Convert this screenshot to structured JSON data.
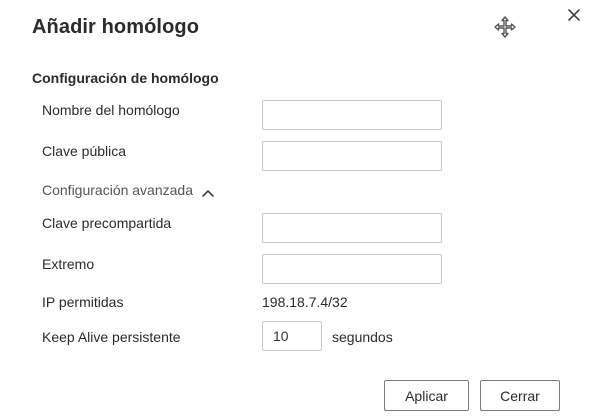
{
  "dialog": {
    "title": "Añadir homólogo"
  },
  "section": {
    "title": "Configuración de homólogo"
  },
  "fields": {
    "peer_name": {
      "label": "Nombre del homólogo",
      "value": ""
    },
    "public_key": {
      "label": "Clave pública",
      "value": ""
    },
    "advanced": {
      "label": "Configuración avanzada",
      "expanded": true
    },
    "preshared_key": {
      "label": "Clave precompartida",
      "value": ""
    },
    "endpoint": {
      "label": "Extremo",
      "value": ""
    },
    "allowed_ips": {
      "label": "IP permitidas",
      "value": "198.18.7.4/32"
    },
    "keepalive": {
      "label": "Keep Alive persistente",
      "value": "10",
      "unit": "segundos"
    }
  },
  "buttons": {
    "apply": "Aplicar",
    "cancel": "Cerrar"
  },
  "icons": {
    "move": "move-icon",
    "close": "close-icon",
    "chevron": "chevron-up-icon"
  },
  "colors": {
    "text": "#2b2b2b",
    "border": "#c8c8c8",
    "button_border": "#7a7a7a"
  }
}
